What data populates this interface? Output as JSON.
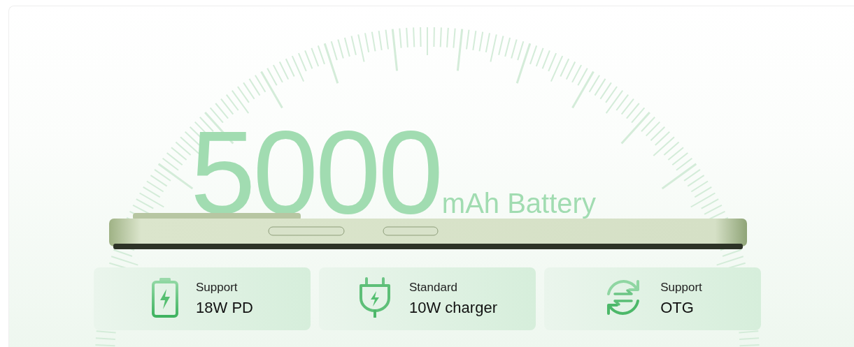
{
  "headline": {
    "value": "5000",
    "unit": "mAh Battery"
  },
  "features": [
    {
      "kind": "battery",
      "label": "Support",
      "value": "18W PD"
    },
    {
      "kind": "plug",
      "label": "Standard",
      "value": "10W charger"
    },
    {
      "kind": "otg",
      "label": "Support",
      "value": "OTG"
    }
  ]
}
